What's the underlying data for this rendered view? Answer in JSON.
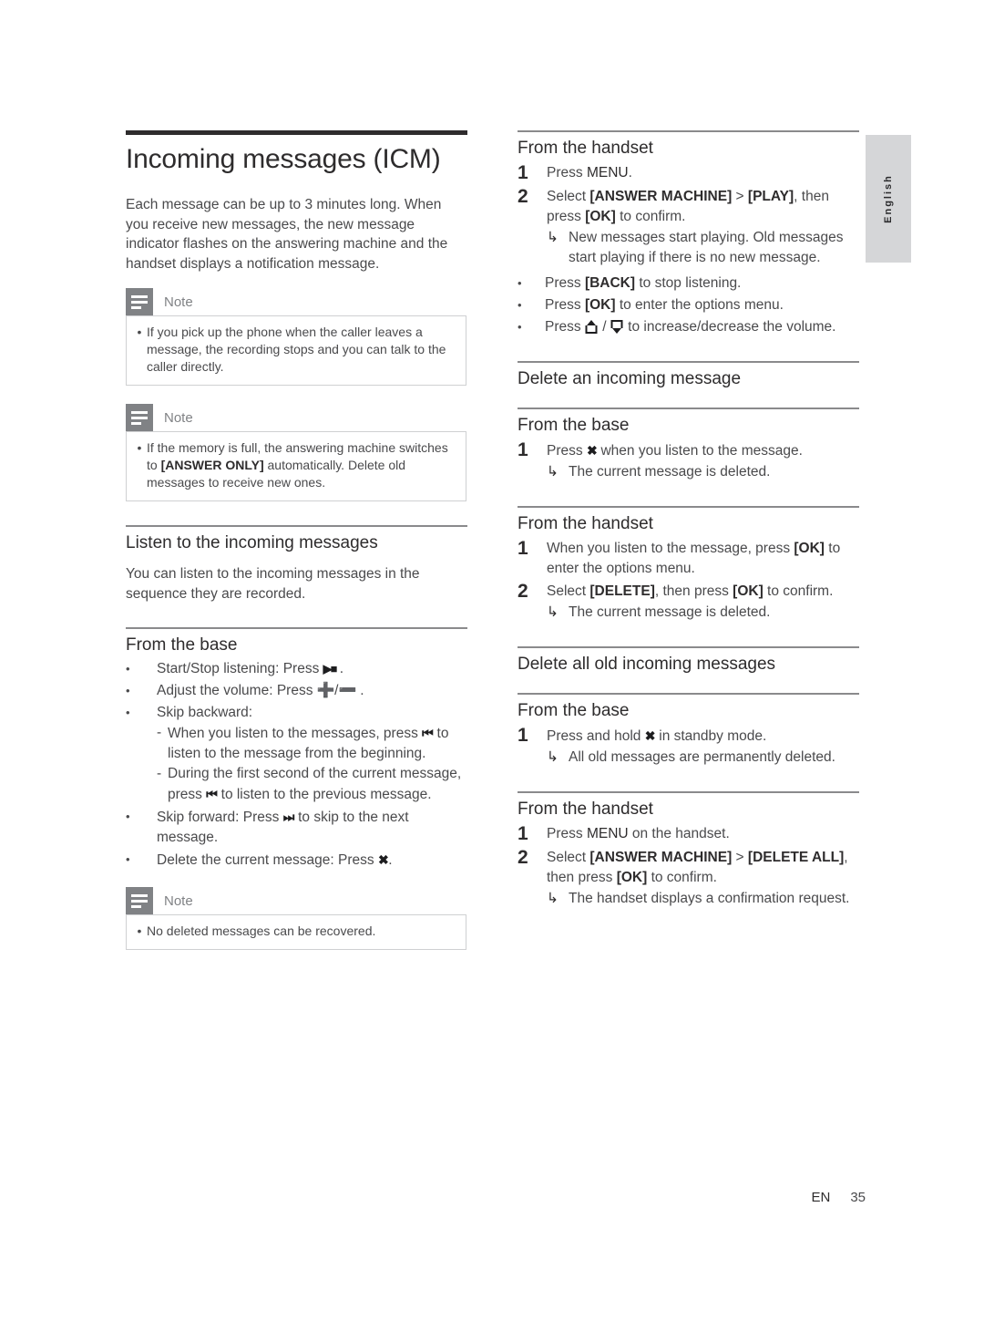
{
  "document": {
    "language_tab": "English",
    "footer": {
      "locale": "EN",
      "page_number": "35"
    }
  },
  "left_column": {
    "title": "Incoming messages (ICM)",
    "intro": "Each message can be up to 3 minutes long. When you receive new messages, the new message indicator flashes on the answering machine and the handset displays a notification message.",
    "note_1": {
      "label": "Note",
      "items": [
        "If you pick up the phone when the caller leaves a message, the recording stops and you can talk to the caller directly."
      ]
    },
    "note_2": {
      "label": "Note",
      "item_prefix": "If the memory is full, the answering machine switches to ",
      "item_keyword": "[ANSWER ONLY]",
      "item_suffix": " automatically. Delete old messages to receive new ones."
    },
    "listen_section": {
      "heading": "Listen to the incoming messages",
      "body": "You can listen to the incoming messages in the sequence they are recorded.",
      "from_the_base": {
        "heading": "From the base",
        "bullets": {
          "start_stop_prefix": "Start/Stop listening: Press ",
          "start_stop_glyph": "▶■",
          "start_stop_suffix": " .",
          "volume_prefix": "Adjust the volume: Press ",
          "volume_glyph_plus": "➕",
          "volume_glyph_sep": "/",
          "volume_glyph_minus": "➖",
          "volume_suffix": " .",
          "skip_backward_label": "Skip backward:",
          "skip_backward_sub_1_a": "When you listen to the messages, press ",
          "skip_backward_sub_1_glyph": "⏮",
          "skip_backward_sub_1_b": " to listen to the message from the beginning.",
          "skip_backward_sub_2_a": "During the first second of the current message, press ",
          "skip_backward_sub_2_glyph": "⏮",
          "skip_backward_sub_2_b": " to listen to the previous message.",
          "skip_forward_a": "Skip forward: Press ",
          "skip_forward_glyph": "⏭",
          "skip_forward_b": " to skip to the next message.",
          "delete_a": "Delete the current message: Press ",
          "delete_glyph": "✖",
          "delete_b": "."
        }
      }
    },
    "note_3": {
      "label": "Note",
      "items": [
        "No deleted messages can be recovered."
      ]
    }
  },
  "right_column": {
    "play_from_handset": {
      "heading": "From the handset",
      "step1": {
        "num": "1",
        "text_prefix": "Press ",
        "keyword": "MENU",
        "text_suffix": "."
      },
      "step2": {
        "num": "2",
        "a": "Select ",
        "kw1": "[ANSWER MACHINE]",
        "b": " > ",
        "kw2": "[PLAY]",
        "c": ", then press ",
        "kw3": "[OK]",
        "d": " to confirm.",
        "result": "New messages start playing. Old messages start playing if there is no new message."
      },
      "bullets": {
        "back_a": "Press ",
        "back_kw": "[BACK]",
        "back_b": " to stop listening.",
        "ok_a": "Press ",
        "ok_kw": "[OK]",
        "ok_b": " to enter the options menu.",
        "volume_a": "Press ",
        "volume_sep": " / ",
        "volume_b": " to increase/decrease the volume."
      }
    },
    "delete_one": {
      "heading": "Delete an incoming message",
      "from_the_base": {
        "heading": "From the base",
        "step1": {
          "num": "1",
          "a": "Press ",
          "glyph": "✖",
          "b": " when you listen to the message.",
          "result": "The current message is deleted."
        }
      },
      "from_the_handset": {
        "heading": "From the handset",
        "step1": {
          "num": "1",
          "a": "When you listen to the message, press ",
          "kw": "[OK]",
          "b": " to enter the options menu."
        },
        "step2": {
          "num": "2",
          "a": "Select ",
          "kw1": "[DELETE]",
          "b": ", then press ",
          "kw2": "[OK]",
          "c": " to confirm.",
          "result": "The current message is deleted."
        }
      }
    },
    "delete_all": {
      "heading": "Delete all old incoming messages",
      "from_the_base": {
        "heading": "From the base",
        "step1": {
          "num": "1",
          "a": "Press and hold ",
          "glyph": "✖",
          "b": " in standby mode.",
          "result": "All old messages are permanently deleted."
        }
      },
      "from_the_handset": {
        "heading": "From the handset",
        "step1": {
          "num": "1",
          "a": "Press ",
          "kw": "MENU",
          "b": " on the handset."
        },
        "step2": {
          "num": "2",
          "a": "Select ",
          "kw1": "[ANSWER MACHINE]",
          "b": " > ",
          "kw2": "[DELETE ALL]",
          "c": ", then press ",
          "kw3": "[OK]",
          "d": " to confirm.",
          "result": "The handset displays a confirmation request."
        }
      }
    }
  }
}
